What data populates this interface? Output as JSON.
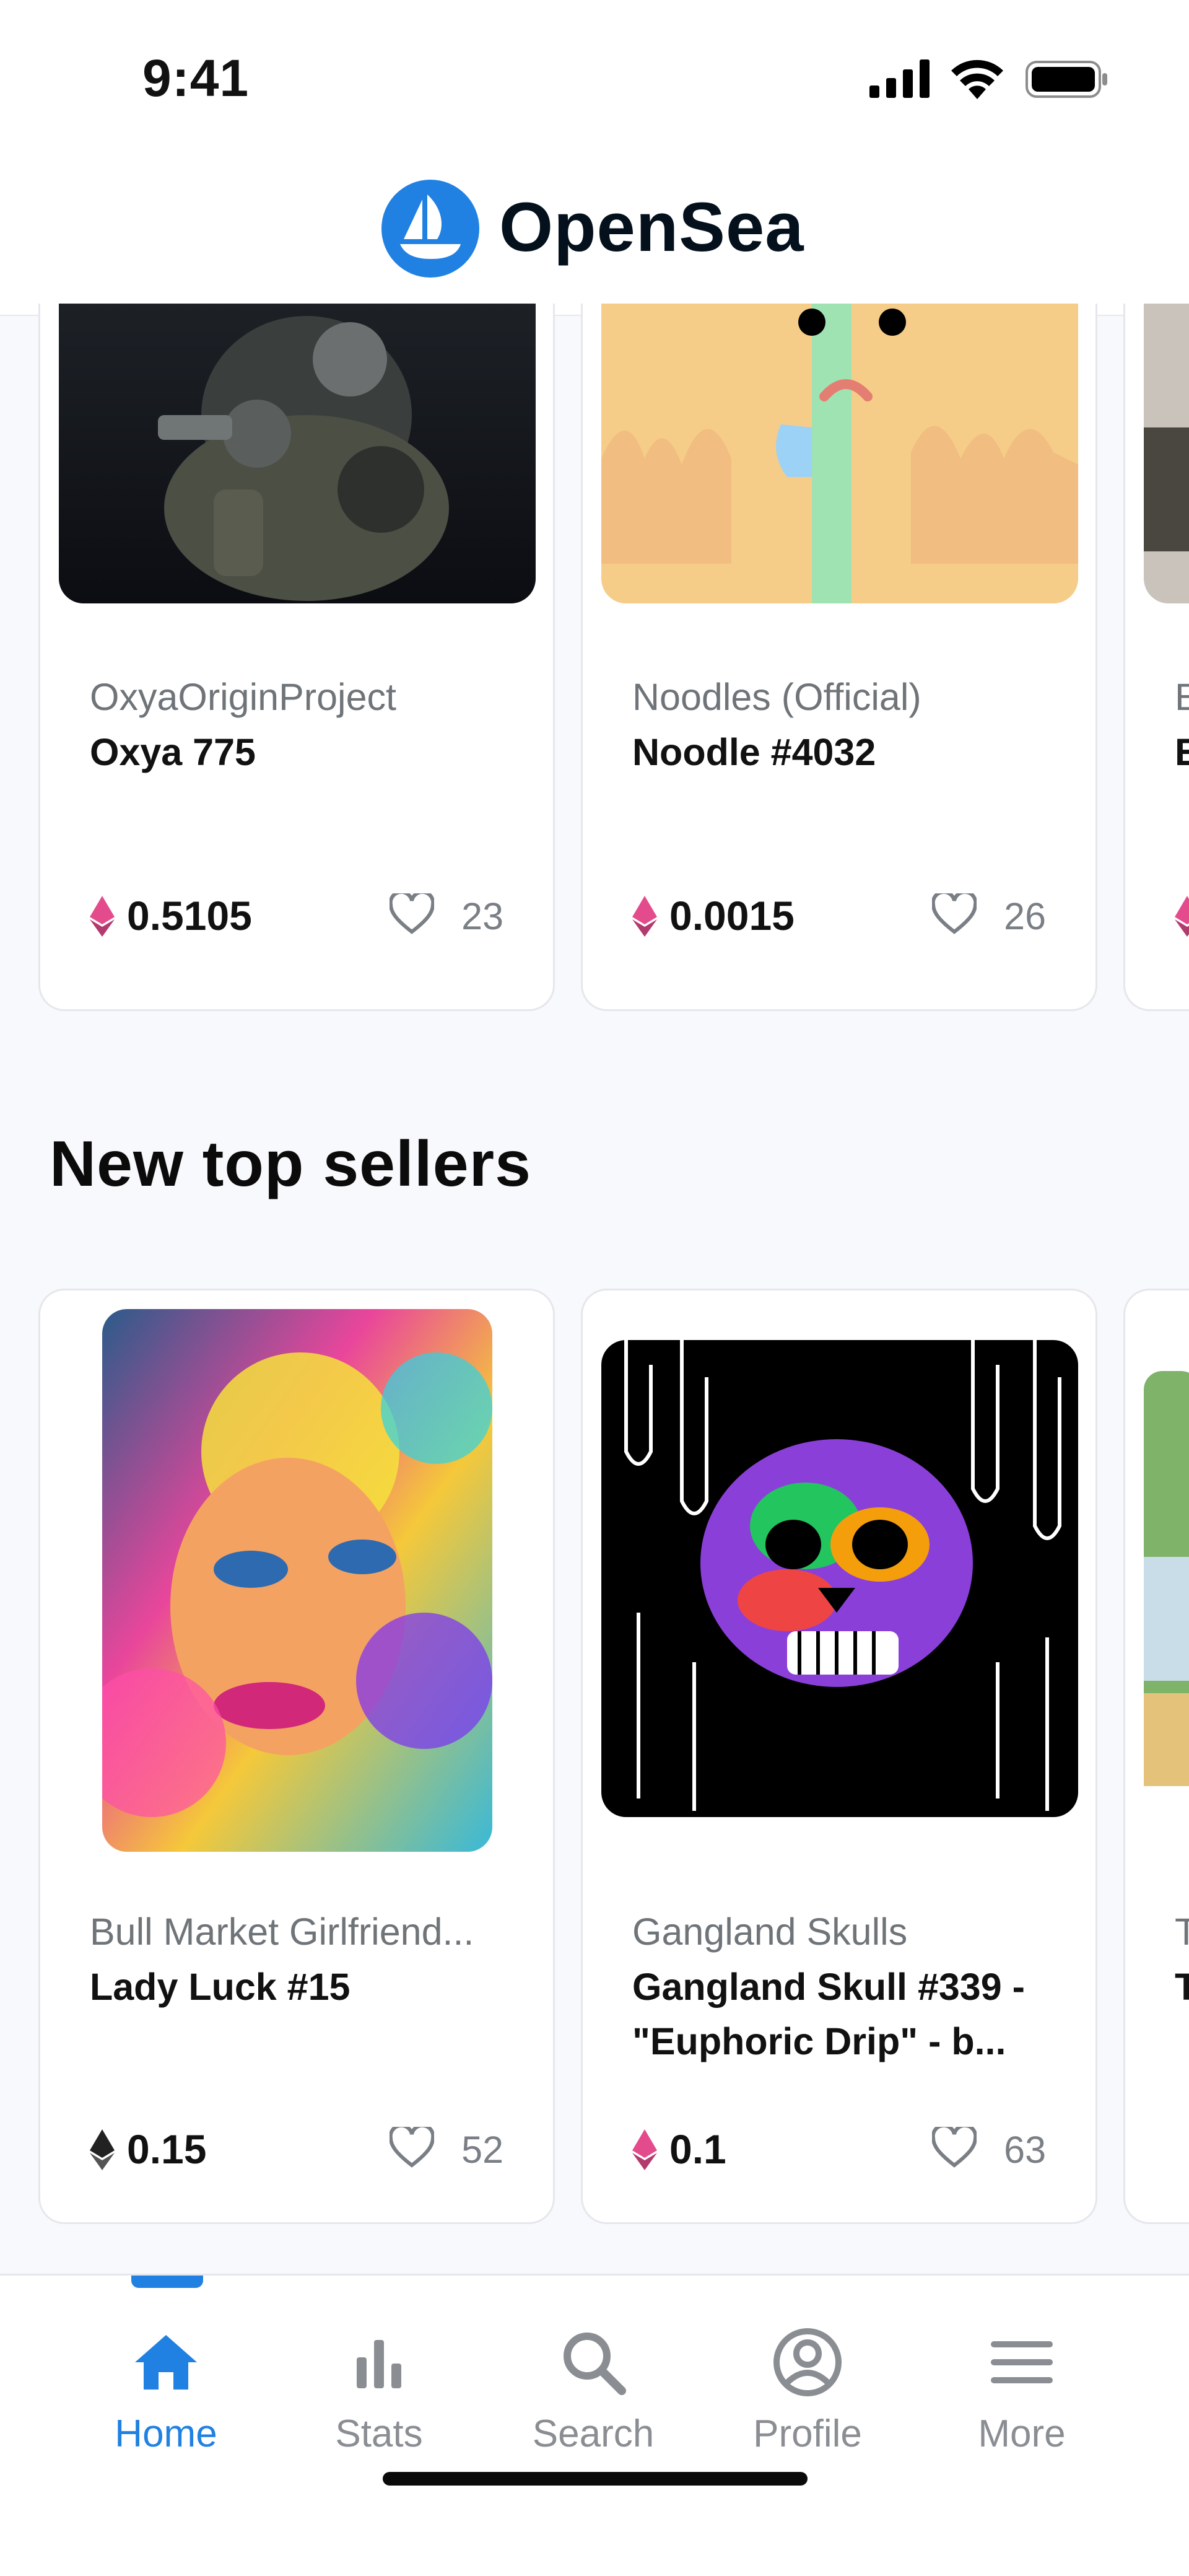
{
  "status_bar": {
    "time": "9:41"
  },
  "header": {
    "brand": "OpenSea"
  },
  "row1": [
    {
      "collection": "OxyaOriginProject",
      "name": "Oxya 775",
      "price": "0.5105",
      "likes": "23"
    },
    {
      "collection": "Noodles (Official)",
      "name": "Noodle #4032",
      "price": "0.0015",
      "likes": "26"
    },
    {
      "collection": "E",
      "name": "E",
      "price": "",
      "likes": ""
    }
  ],
  "sections": {
    "new_top_sellers": "New top sellers"
  },
  "row2": [
    {
      "collection": "Bull Market Girlfriend...",
      "name": "Lady Luck #15",
      "price": "0.15",
      "likes": "52"
    },
    {
      "collection": "Gangland Skulls",
      "name": "Gangland Skull #339 - \"Euphoric Drip\" - b...",
      "price": "0.1",
      "likes": "63"
    },
    {
      "collection": "T",
      "name": "T",
      "price": "",
      "likes": ""
    }
  ],
  "nav": [
    {
      "label": "Home",
      "icon": "home-icon",
      "active": true
    },
    {
      "label": "Stats",
      "icon": "stats-icon"
    },
    {
      "label": "Search",
      "icon": "search-icon"
    },
    {
      "label": "Profile",
      "icon": "profile-icon"
    },
    {
      "label": "More",
      "icon": "menu-icon"
    }
  ],
  "colors": {
    "accent": "#2081e2",
    "eth_pink": "#e44b8d",
    "eth_dark": "#222222"
  }
}
